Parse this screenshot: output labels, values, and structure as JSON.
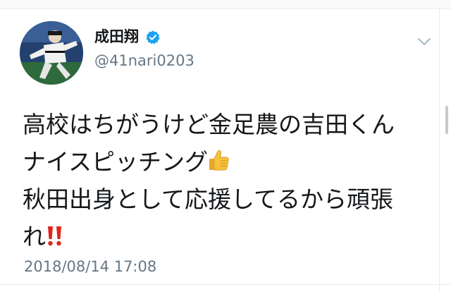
{
  "tweet": {
    "author_name": "成田翔",
    "author_handle": "@41nari0203",
    "verified": true,
    "text_lines": [
      "高校はちがうけど金足農の吉田くん",
      "ナイスピッチング",
      "秋田出身として応援してるから頑張",
      "れ"
    ],
    "emojis": [
      "thumbs-up-icon",
      "double-exclamation-icon"
    ],
    "timestamp": "2018/08/14 17:08"
  },
  "colors": {
    "verified_blue": "#1da1f2",
    "secondary_text": "#657786",
    "primary_text": "#14171a",
    "exclamation_red": "#e0241b",
    "thumb_yellow": "#f7c23d"
  }
}
